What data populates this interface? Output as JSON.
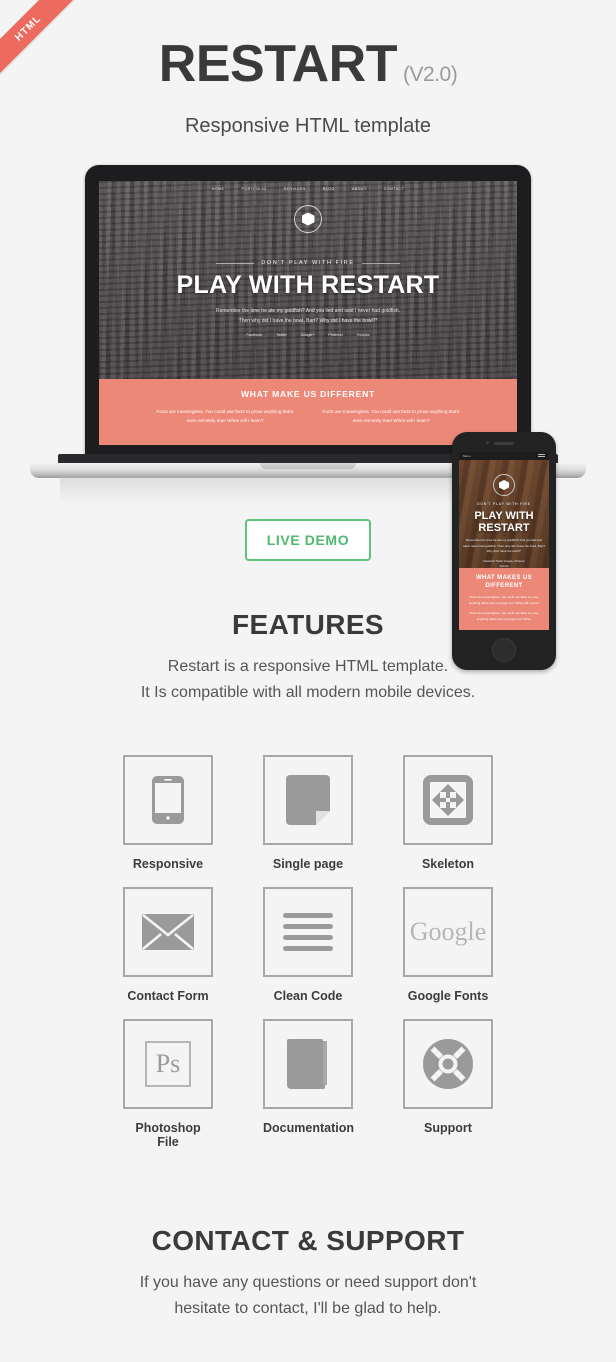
{
  "ribbon": {
    "label": "HTML",
    "color": "#ec6b5e"
  },
  "header": {
    "title": "RESTART",
    "version": "(V2.0)",
    "subtitle": "Responsive HTML template"
  },
  "mockup": {
    "laptop_screen": {
      "nav": [
        "HOME",
        "PORTFOLIO",
        "SERVICES",
        "BLOG",
        "ABOUT",
        "CONTACT"
      ],
      "kicker": "DON'T PLAY WITH FIRE",
      "hero": "PLAY WITH RESTART",
      "hero_sub_line1": "Remember the time he ate my goldfish? And you lied and said I never had goldfish.",
      "hero_sub_line2": "Then why did I have the bowl, Bart? Why did I have the bowl?*",
      "socials": [
        "Facebook",
        "Twitter",
        "Google+",
        "Pinterest",
        "Youtube"
      ],
      "band_title": "WHAT MAKE US DIFFERENT",
      "band_col1": "Facts are meaningless. You could use facts to prove anything that's even remotely true! When will I learn?",
      "band_col2": "Facts are meaningless. You could use facts to prove anything that's even remotely true! When will I learn?",
      "band_color": "#ec8878"
    },
    "phone_screen": {
      "menu_label": "Menu",
      "kicker": "DON'T PLAY WITH FIRE",
      "hero_line1": "PLAY WITH",
      "hero_line2": "RESTART",
      "hero_sub": "Remember the time he ate my goldfish? And you lied and said I never had goldfish. Then why did I have the bowl, Bart? Why did I have the bowl?*",
      "socials_line1": "Facebook     Twitter     Google+     Pinterest",
      "socials_line2": "Youtube",
      "band_title_line1": "WHAT MAKES US",
      "band_title_line2": "DIFFERENT",
      "band_text1": "Facts are meaningless. You could use facts to prove anything that's even remotely true! When will I learn?",
      "band_text2": "Facts are meaningless. You could use facts to prove anything that's even remotely true! When"
    }
  },
  "live_demo": {
    "label": "LIVE DEMO",
    "color": "#5cc47c"
  },
  "features": {
    "title": "FEATURES",
    "desc_line1": "Restart is a responsive HTML template.",
    "desc_line2": "It Is compatible with all modern mobile devices.",
    "items": [
      {
        "label": "Responsive",
        "icon": "mobile-phone-icon"
      },
      {
        "label": "Single page",
        "icon": "page-fold-icon"
      },
      {
        "label": "Skeleton",
        "icon": "expand-arrows-icon"
      },
      {
        "label": "Contact Form",
        "icon": "envelope-icon"
      },
      {
        "label": "Clean Code",
        "icon": "code-lines-icon"
      },
      {
        "label": "Google Fonts",
        "icon": "google-text-icon",
        "text": "Google"
      },
      {
        "label": "Photoshop File",
        "icon": "photoshop-icon",
        "text": "Ps"
      },
      {
        "label": "Documentation",
        "icon": "book-icon"
      },
      {
        "label": "Support",
        "icon": "life-ring-icon"
      }
    ]
  },
  "contact": {
    "title": "CONTACT & SUPPORT",
    "desc_line1": "If you have any questions or need support don't",
    "desc_line2": "hesitate to contact, I'll be glad to help."
  }
}
